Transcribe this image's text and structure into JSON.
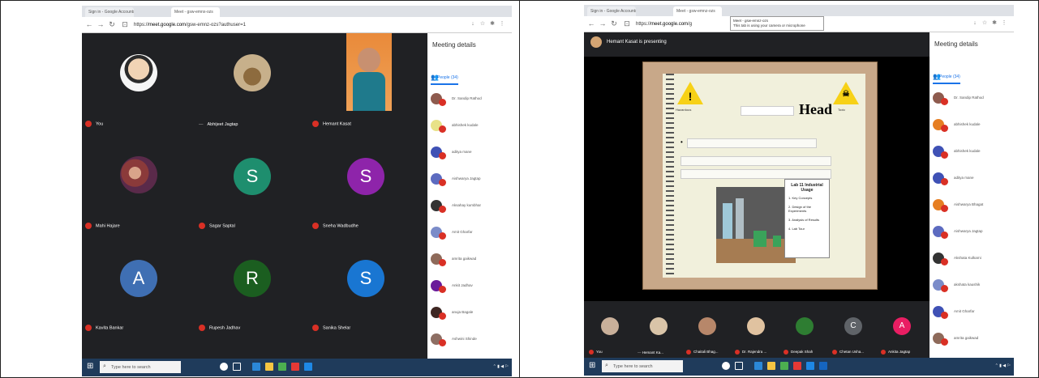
{
  "left": {
    "tabs": [
      "Sign in - Google Accounts",
      "Meet - gsw-emnx-ozs"
    ],
    "url_prefix": "https://",
    "url_domain": "meet.google.com",
    "url_path": "/gsw-emnz-ozs?authuser=1",
    "panel_title": "Meeting details",
    "people_tab": "People (34)",
    "people": [
      {
        "name": "Dr. Sandip Rathod",
        "color": "#8e5b4e"
      },
      {
        "name": "abhishek kudale",
        "color": "#e8e288"
      },
      {
        "name": "aditya mane",
        "color": "#3f51b5"
      },
      {
        "name": "Aishwarya Jagtap",
        "color": "#5c6bc0"
      },
      {
        "name": "Aksahay kumbhar",
        "color": "#333333"
      },
      {
        "name": "Amit Gharfar",
        "color": "#7b8cc9"
      },
      {
        "name": "amrita gaikwad",
        "color": "#8e6a5a"
      },
      {
        "name": "Ankit Jadhav",
        "color": "#6a1b9a"
      },
      {
        "name": "anuja Bagale",
        "color": "#3e2723"
      },
      {
        "name": "Ashwini Shinde",
        "color": "#8d6e63"
      }
    ],
    "tiles": [
      {
        "name": "You",
        "avatar": "",
        "color": "#c9b09a",
        "kind": "photo",
        "muted": true
      },
      {
        "name": "Abhijeet Jagtap",
        "avatar": "",
        "color": "#a08c6c",
        "kind": "photo",
        "muted": false
      },
      {
        "name": "Hemant Kasat",
        "avatar": "",
        "color": "#e67e22",
        "kind": "video",
        "muted": true
      },
      {
        "name": "Mahi Hajare",
        "avatar": "",
        "color": "#8b3a3a",
        "kind": "photo",
        "muted": true
      },
      {
        "name": "Sagar Saptal",
        "avatar": "S",
        "color": "#1e8e6e",
        "kind": "letter",
        "muted": true
      },
      {
        "name": "Sneha Wadbudhe",
        "avatar": "S",
        "color": "#8e24aa",
        "kind": "letter",
        "muted": true
      },
      {
        "name": "Kavita Bankar",
        "avatar": "A",
        "color": "#3f6fb3",
        "kind": "letter",
        "muted": true
      },
      {
        "name": "Rupesh Jadhav",
        "avatar": "R",
        "color": "#1b5e20",
        "kind": "letter",
        "muted": true
      },
      {
        "name": "Sanika Shelar",
        "avatar": "S",
        "color": "#1976d2",
        "kind": "letter",
        "muted": true
      }
    ],
    "search_placeholder": "Type here to search"
  },
  "right": {
    "tabs": [
      "Sign in - Google Accounts",
      "Meet - gsw-emnz-ozs"
    ],
    "url_prefix": "https://",
    "url_domain": "meet.google.com",
    "url_path": "/g",
    "tooltip_line1": "Meet - gsw-emnz-ozs",
    "tooltip_line2": "This tab is using your camera or microphone",
    "presenter_text": "Hemant Kasat is presenting",
    "panel_title": "Meeting details",
    "people_tab": "People (34)",
    "people": [
      {
        "name": "Dr. Sandip Rathod",
        "color": "#8e5b4e"
      },
      {
        "name": "abhishek kudale",
        "color": "#e67e22"
      },
      {
        "name": "abhishek kudale",
        "color": "#3f51b5"
      },
      {
        "name": "aditya mane",
        "color": "#3f51b5"
      },
      {
        "name": "Aishwarya Bhagat",
        "color": "#e67e22"
      },
      {
        "name": "Aishwarya Jagtap",
        "color": "#5c6bc0"
      },
      {
        "name": "Akshata Kulkarni",
        "color": "#333333"
      },
      {
        "name": "akshata kaushik",
        "color": "#7b8cc9"
      },
      {
        "name": "Amit Gharfar",
        "color": "#3f51b5"
      },
      {
        "name": "amrita gaikwad",
        "color": "#8e6a5a"
      }
    ],
    "slide_title": "Head",
    "warn_labels": [
      "Hazardous",
      "Toxic"
    ],
    "lab_note_title": "Lab 11 Industrial Usage",
    "lab_note_items": [
      "1. Key Concepts",
      "2. Design of the Experiments",
      "3. Analysis of Results",
      "4. Lab Tour"
    ],
    "strip": [
      {
        "name": "You",
        "avatar": "",
        "color": "#c9b09a",
        "muted": true
      },
      {
        "name": "Hemant Ka...",
        "avatar": "",
        "color": "#d9c4a8",
        "muted": false
      },
      {
        "name": "Chaitali Bhag...",
        "avatar": "",
        "color": "#b7876a",
        "muted": true
      },
      {
        "name": "Dr. Rajendra ...",
        "avatar": "",
        "color": "#e0c2a0",
        "muted": true
      },
      {
        "name": "Deepak Shah",
        "avatar": "",
        "color": "#2e7d32",
        "muted": true
      },
      {
        "name": "Chetan Usha...",
        "avatar": "C",
        "color": "#5f6368",
        "muted": true
      },
      {
        "name": "Ankita Jagtap",
        "avatar": "A",
        "color": "#e91e63",
        "muted": true
      }
    ],
    "search_placeholder": "Type here to search"
  }
}
